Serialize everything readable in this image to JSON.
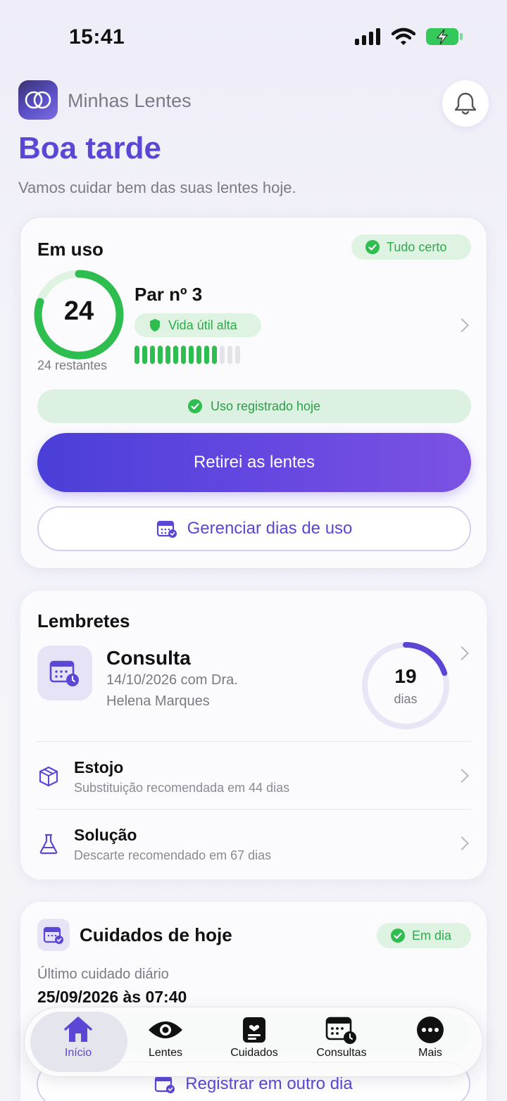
{
  "status_bar": {
    "time": "15:41"
  },
  "header": {
    "app_name": "Minhas Lentes"
  },
  "greeting": "Boa tarde",
  "subgreeting": "Vamos cuidar bem das suas lentes hoje.",
  "in_use": {
    "title": "Em uso",
    "status_badge": "Tudo certo",
    "remaining_count": "24",
    "remaining_label": "24 restantes",
    "remaining_fraction": 0.8,
    "pair_title": "Par nº 3",
    "lifespan_badge": "Vida útil alta",
    "life_bars_filled": 11,
    "life_bars_total": 14,
    "registered_today": "Uso registrado hoje",
    "primary_button": "Retirei as lentes",
    "manage_button": "Gerenciar dias de uso"
  },
  "reminders": {
    "title": "Lembretes",
    "consulta": {
      "title": "Consulta",
      "line1": "14/10/2026 com Dra.",
      "line2": "Helena Marques",
      "days": "19",
      "days_unit": "dias",
      "ring_fraction": 0.2
    },
    "items": [
      {
        "title": "Estojo",
        "subtitle": "Substituição recomendada em 44 dias"
      },
      {
        "title": "Solução",
        "subtitle": "Descarte recomendado em 67 dias"
      }
    ]
  },
  "care_today": {
    "title": "Cuidados de hoje",
    "status_badge": "Em dia",
    "last_care_label": "Último cuidado diário",
    "last_care_value": "25/09/2026 às 07:40",
    "register_other_button": "Registrar em outro dia"
  },
  "tab_bar": {
    "tabs": [
      {
        "label": "Início",
        "icon": "home-icon",
        "active": true
      },
      {
        "label": "Lentes",
        "icon": "eye-icon",
        "active": false
      },
      {
        "label": "Cuidados",
        "icon": "care-icon",
        "active": false
      },
      {
        "label": "Consultas",
        "icon": "calendar-clock-icon",
        "active": false
      },
      {
        "label": "Mais",
        "icon": "more-icon",
        "active": false
      }
    ]
  },
  "colors": {
    "accent": "#5b47d6",
    "success": "#2ebd4f",
    "success_bg": "#dff3e3"
  }
}
